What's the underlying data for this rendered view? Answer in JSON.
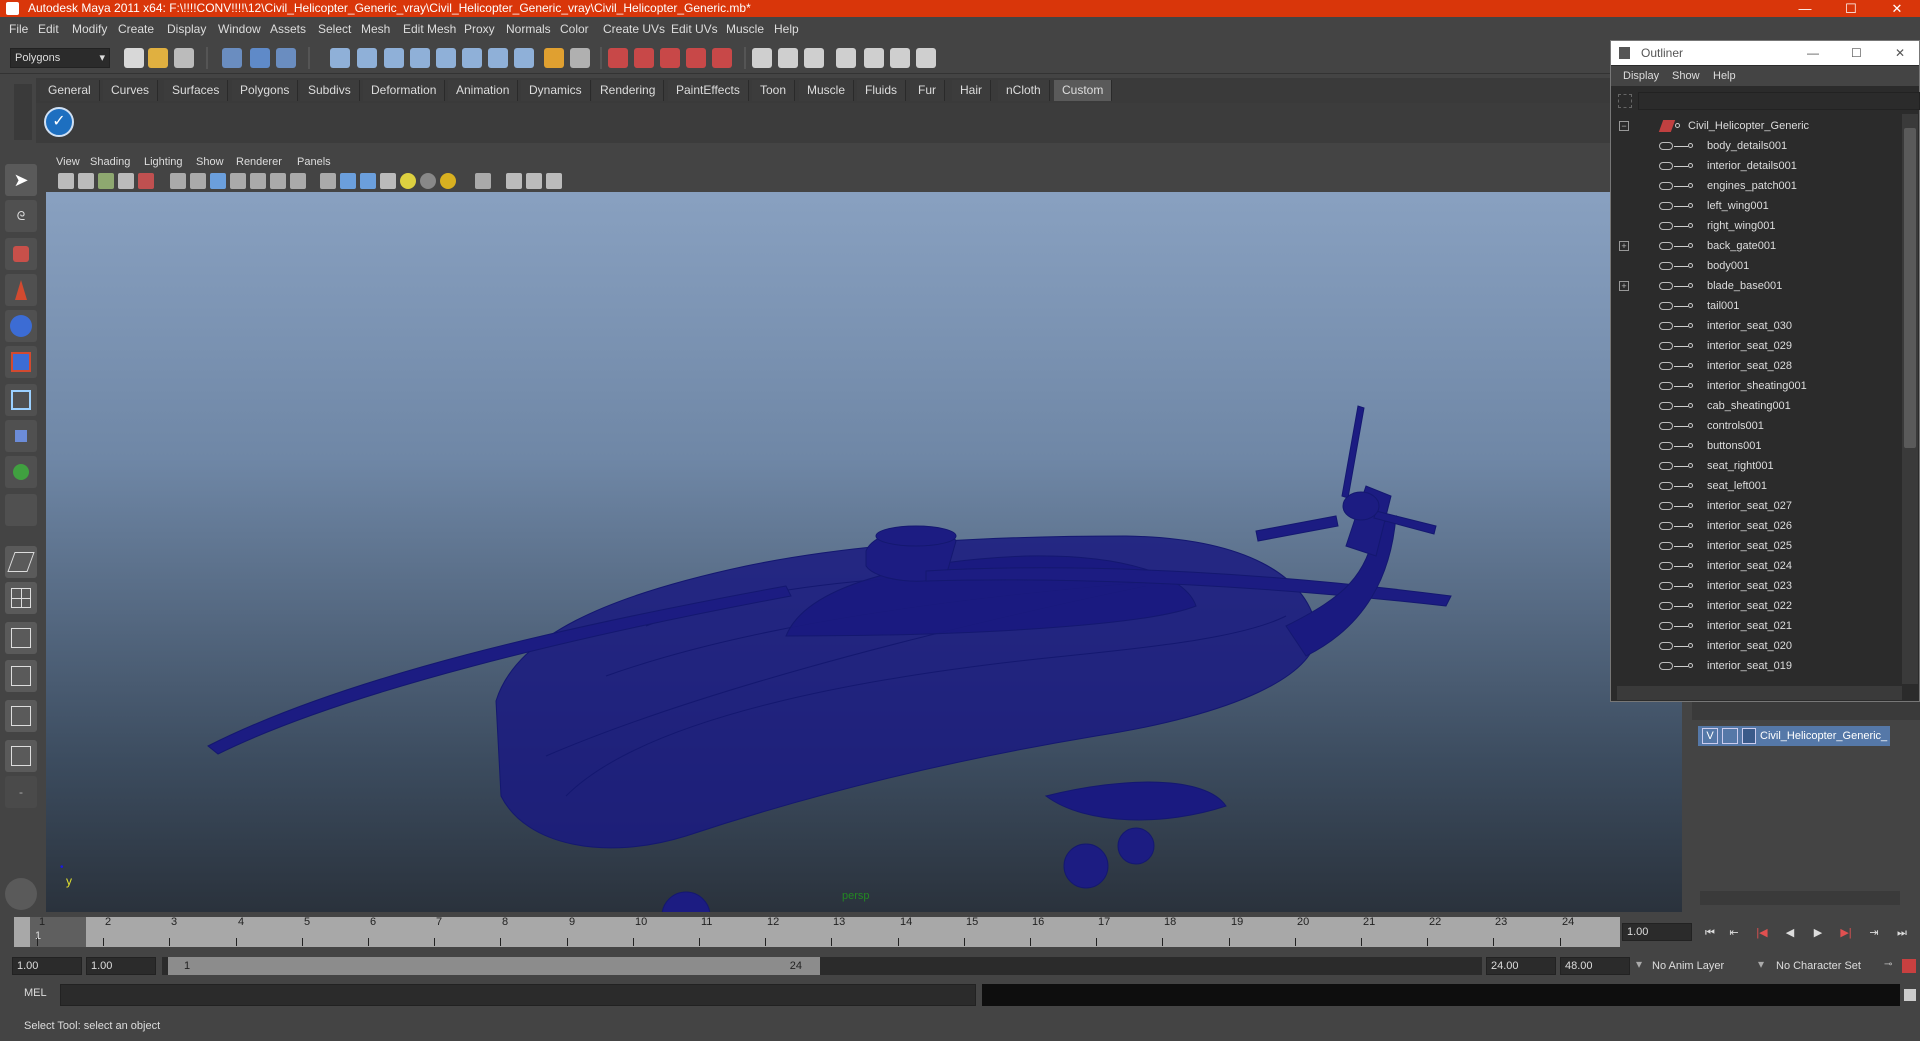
{
  "window": {
    "title": "Autodesk Maya 2011 x64: F:\\!!!!CONV!!!!\\12\\Civil_Helicopter_Generic_vray\\Civil_Helicopter_Generic_vray\\Civil_Helicopter_Generic.mb*",
    "minimize": "—",
    "maximize": "☐",
    "close": "✕"
  },
  "menubar": [
    "File",
    "Edit",
    "Modify",
    "Create",
    "Display",
    "Window",
    "Assets",
    "Select",
    "Mesh",
    "Edit Mesh",
    "Proxy",
    "Normals",
    "Color",
    "Create UVs",
    "Edit UVs",
    "Muscle",
    "Help"
  ],
  "status": {
    "mode": "Polygons"
  },
  "shelf_tabs": [
    "General",
    "Curves",
    "Surfaces",
    "Polygons",
    "Subdivs",
    "Deformation",
    "Animation",
    "Dynamics",
    "Rendering",
    "PaintEffects",
    "Toon",
    "Muscle",
    "Fluids",
    "Fur",
    "Hair",
    "nCloth",
    "Custom"
  ],
  "shelf_active": "Custom",
  "viewport_menu": [
    "View",
    "Shading",
    "Lighting",
    "Show",
    "Renderer",
    "Panels"
  ],
  "viewport": {
    "camera_label": "persp",
    "axis_y": "y"
  },
  "outliner": {
    "title": "Outliner",
    "menu": [
      "Display",
      "Show",
      "Help"
    ],
    "root": "Civil_Helicopter_Generic",
    "items": [
      "body_details001",
      "interior_details001",
      "engines_patch001",
      "left_wing001",
      "right_wing001",
      "back_gate001",
      "body001",
      "blade_base001",
      "tail001",
      "interior_seat_030",
      "interior_seat_029",
      "interior_seat_028",
      "interior_sheating001",
      "cab_sheating001",
      "controls001",
      "buttons001",
      "seat_right001",
      "seat_left001",
      "interior_seat_027",
      "interior_seat_026",
      "interior_seat_025",
      "interior_seat_024",
      "interior_seat_023",
      "interior_seat_022",
      "interior_seat_021",
      "interior_seat_020",
      "interior_seat_019"
    ],
    "expandable": [
      "back_gate001",
      "blade_base001"
    ]
  },
  "layer": {
    "visible": "V",
    "name": "Civil_Helicopter_Generic_"
  },
  "timeline": {
    "ticks": [
      "1",
      "2",
      "3",
      "4",
      "5",
      "6",
      "7",
      "8",
      "9",
      "10",
      "11",
      "12",
      "13",
      "14",
      "15",
      "16",
      "17",
      "18",
      "19",
      "20",
      "21",
      "22",
      "23",
      "24"
    ],
    "current_frame": "1",
    "current_time": "1.00"
  },
  "range": {
    "start": "1.00",
    "playback_start": "1.00",
    "slider_start": "1",
    "slider_end": "24",
    "playback_end": "24.00",
    "end": "48.00",
    "anim_layer": "No Anim Layer",
    "character_set": "No Character Set"
  },
  "cmdline": {
    "label": "MEL"
  },
  "helpline": {
    "text": "Select Tool: select an object"
  },
  "playback": [
    "⏮",
    "⇤",
    "|◀",
    "◀",
    "▶",
    "▶|",
    "⇥",
    "⏭"
  ]
}
